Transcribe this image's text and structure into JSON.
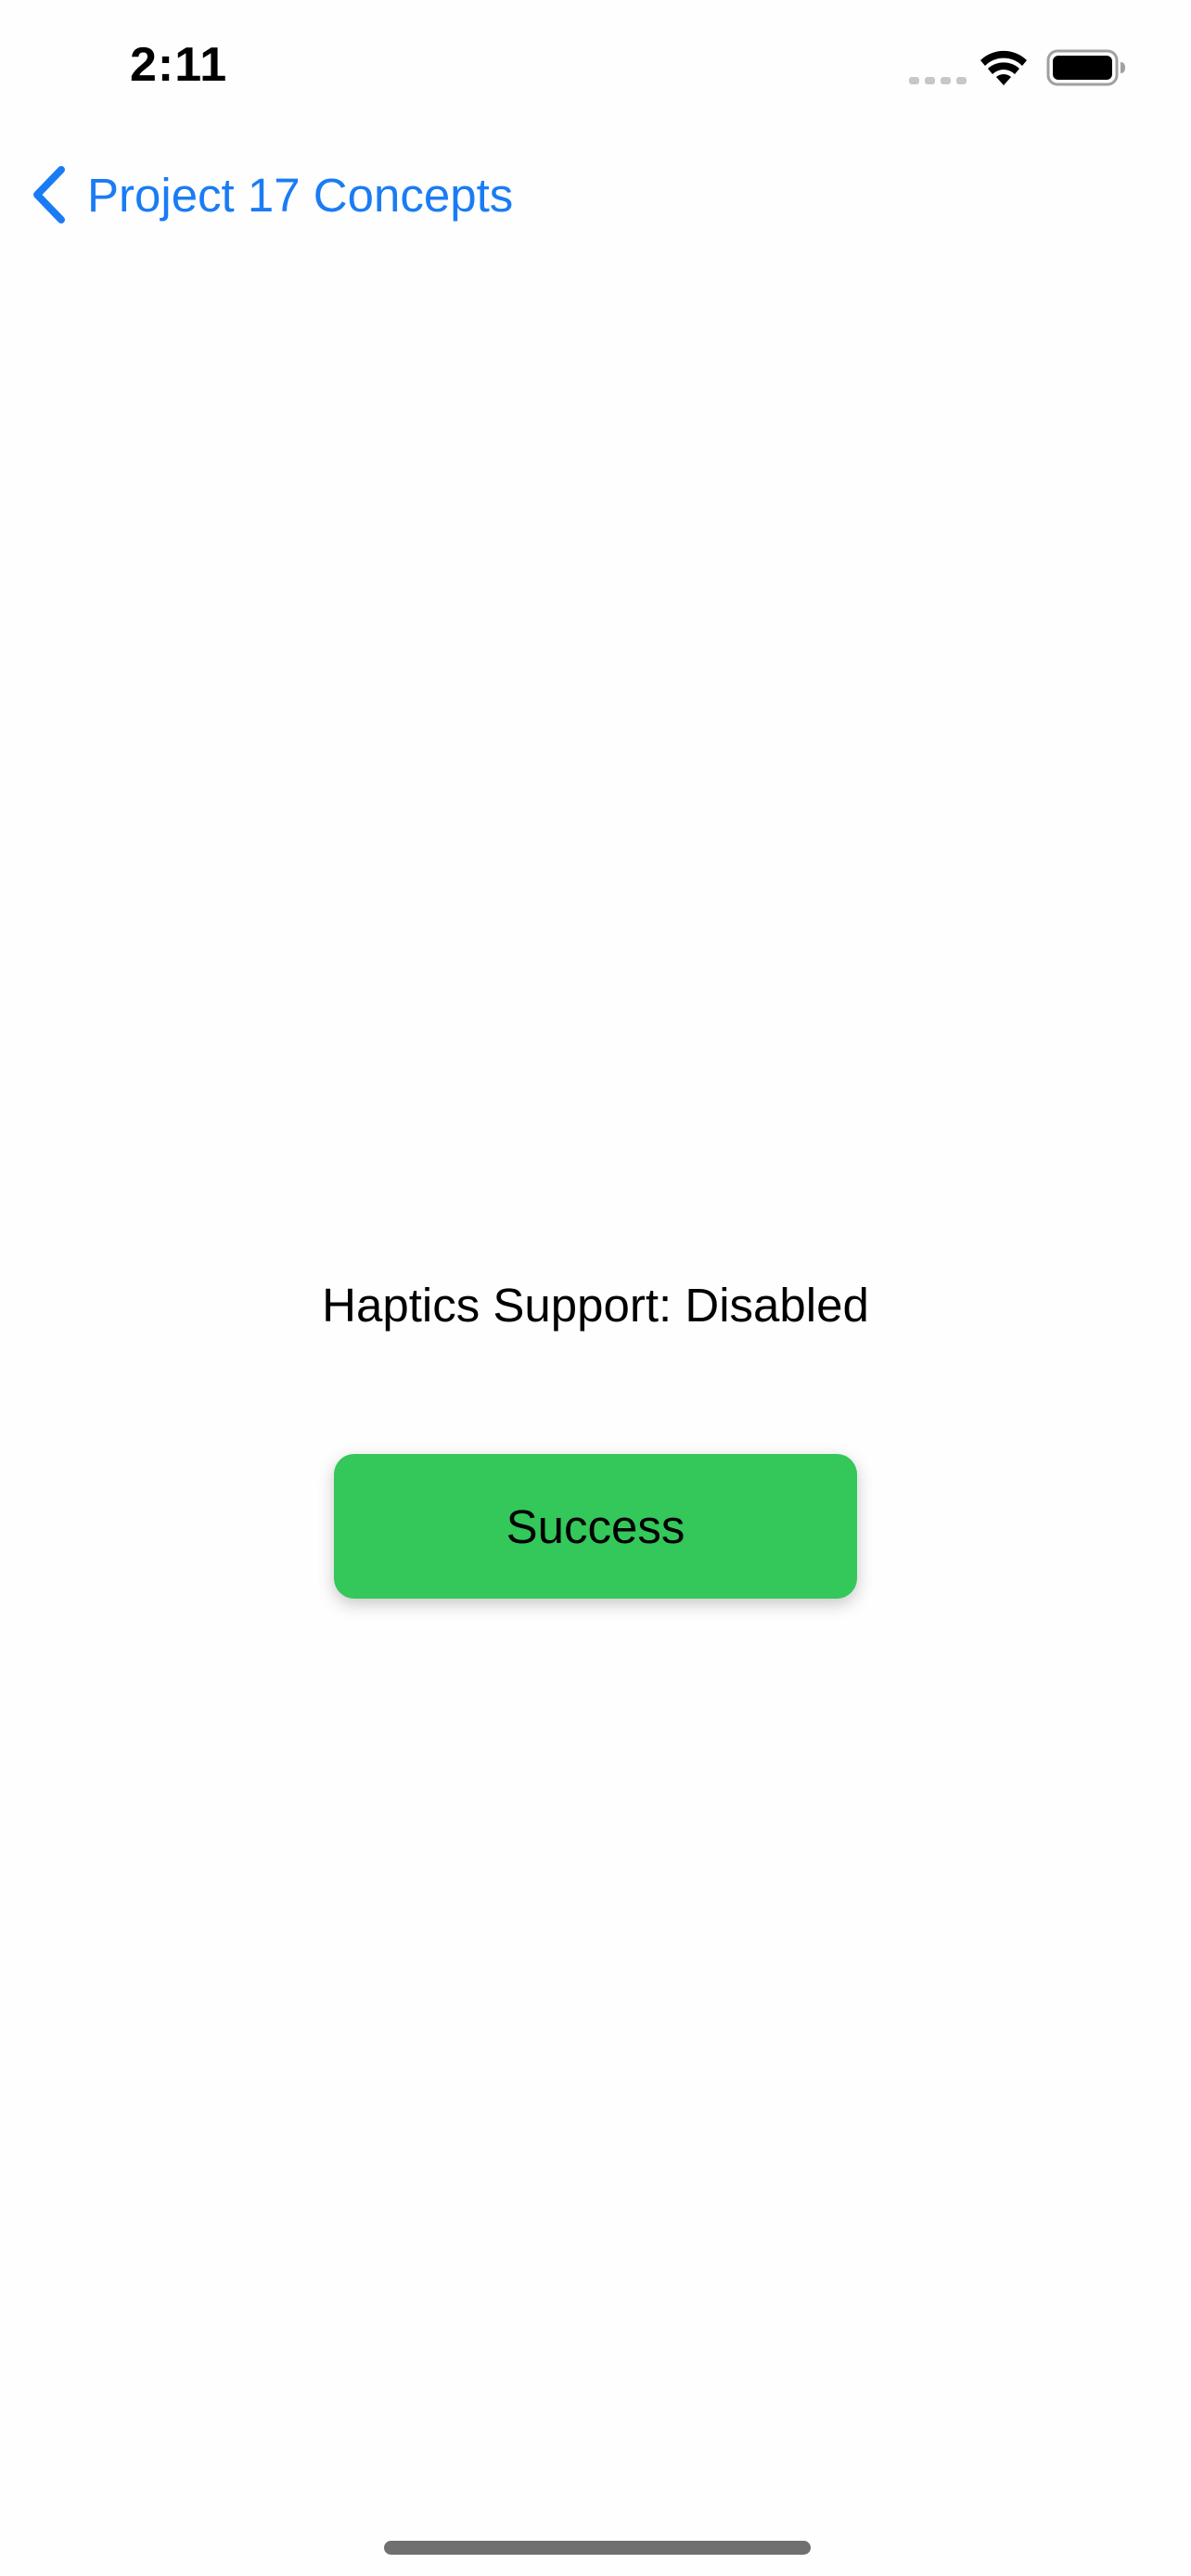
{
  "status_bar": {
    "time": "2:11"
  },
  "nav": {
    "back_label": "Project 17 Concepts"
  },
  "main": {
    "haptics_text": "Haptics Support: Disabled",
    "success_button_label": "Success"
  },
  "colors": {
    "accent": "#1a7cf5",
    "success_button": "#34c75a",
    "background": "#fefefe"
  },
  "icons": {
    "signal": "cellular-signal-icon",
    "wifi": "wifi-icon",
    "battery": "battery-icon",
    "back": "chevron-left-icon"
  }
}
